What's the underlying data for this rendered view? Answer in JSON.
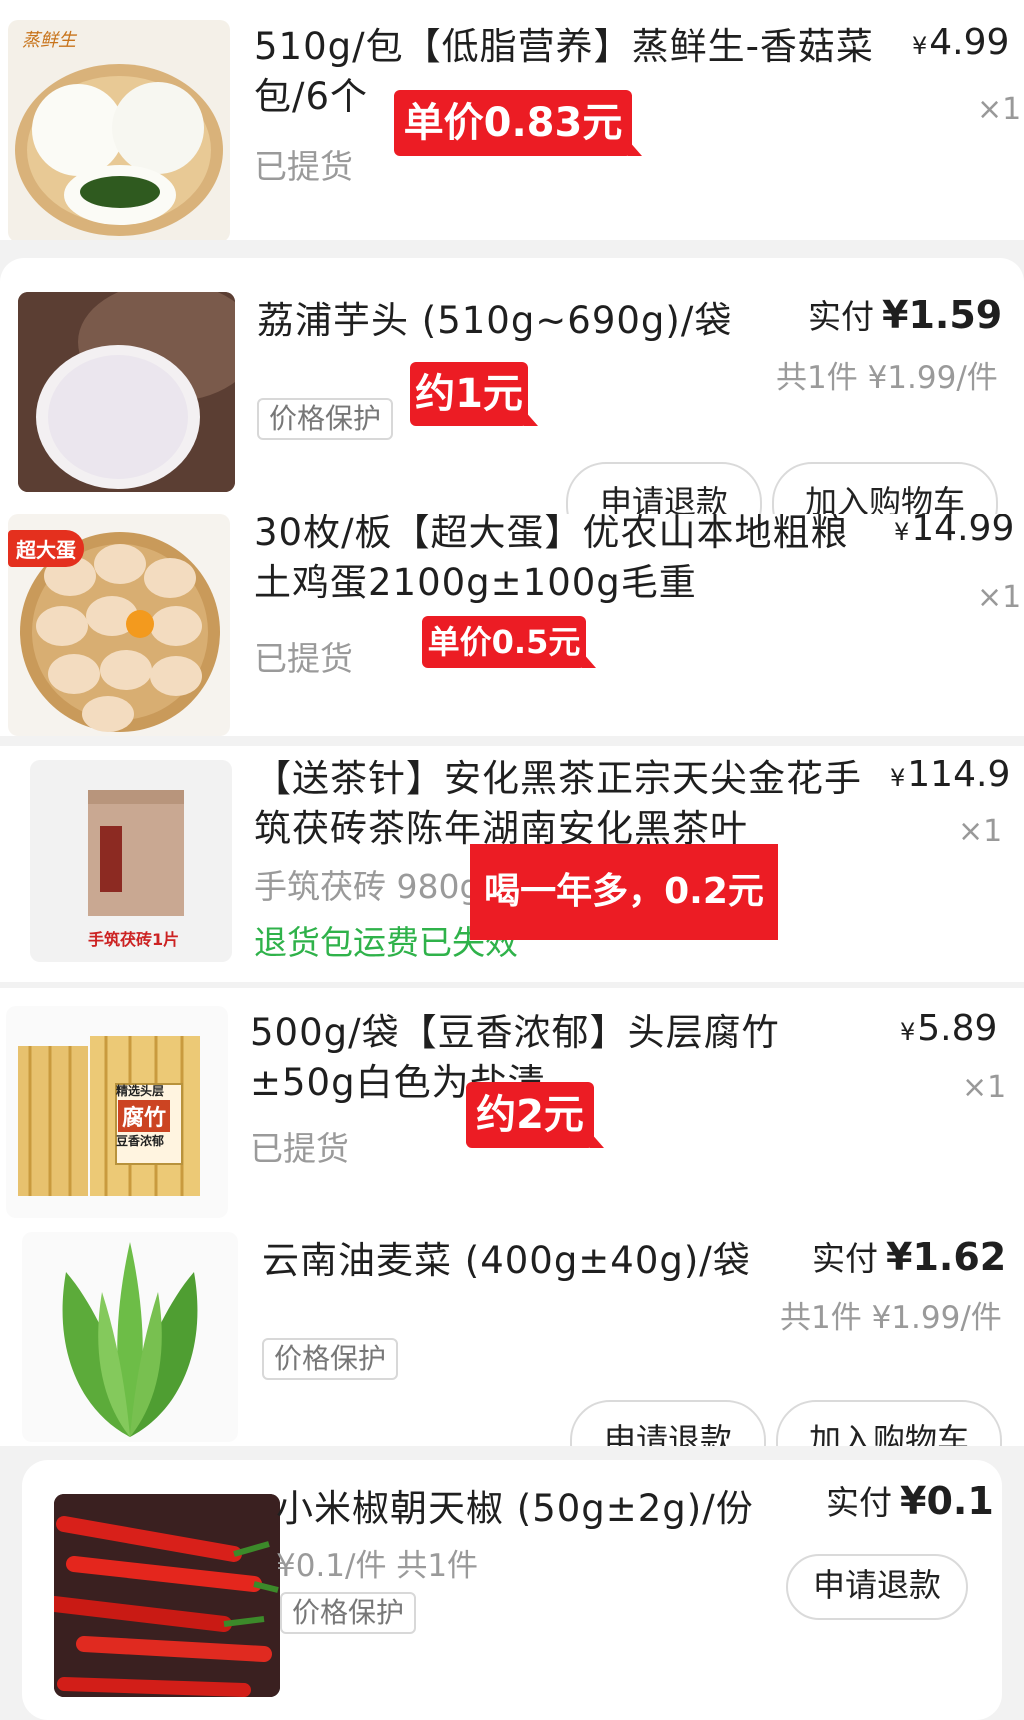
{
  "items": [
    {
      "title": "510g/包【低脂营养】蒸鲜生-香菇菜包/6个",
      "price": "4.99",
      "qty": "×1",
      "status": "已提货",
      "badge": "单价0.83元",
      "brand_logo_text": "蒸鲜生"
    },
    {
      "title": "荔浦芋头 (510g~690g)/袋",
      "paid_label": "实付",
      "paid_value": "¥1.59",
      "unit_info": "共1件 ¥1.99/件",
      "tag": "价格保护",
      "badge": "约1元",
      "buttons": [
        "申请退款",
        "加入购物车"
      ]
    },
    {
      "title": "30枚/板【超大蛋】优农山本地粗粮土鸡蛋2100g±100g毛重",
      "price": "14.99",
      "qty": "×1",
      "status": "已提货",
      "badge": "单价0.5元",
      "corner_badge": "超大蛋"
    },
    {
      "title": "【送茶针】安化黑茶正宗天尖金花手筑茯砖茶陈年湖南安化黑茶叶",
      "price": "114.9",
      "qty": "×1",
      "spec": "手筑茯砖 980g",
      "status": "退货包运费已失效",
      "badge": "喝一年多，0.2元",
      "image_caption": "手筑茯砖1片"
    },
    {
      "title": "500g/袋【豆香浓郁】头层腐竹±50g白色为盐渍",
      "price": "5.89",
      "qty": "×1",
      "status": "已提货",
      "badge": "约2元",
      "image_label": [
        "精选头层",
        "腐竹",
        "豆香浓郁"
      ]
    },
    {
      "title": "云南油麦菜 (400g±40g)/袋",
      "paid_label": "实付",
      "paid_value": "¥1.62",
      "unit_info": "共1件 ¥1.99/件",
      "tag": "价格保护",
      "buttons": [
        "申请退款",
        "加入购物车"
      ]
    },
    {
      "title": "小米椒朝天椒 (50g±2g)/份",
      "paid_label": "实付",
      "paid_value": "¥0.1",
      "unit_info": "¥0.1/件  共1件",
      "tag": "价格保护",
      "buttons": [
        "申请退款"
      ]
    }
  ],
  "currency_symbol": "¥",
  "colors": {
    "badge_red": "#ec1c24",
    "status_green": "#2fb24a",
    "text_gray": "#9a9a9a"
  }
}
